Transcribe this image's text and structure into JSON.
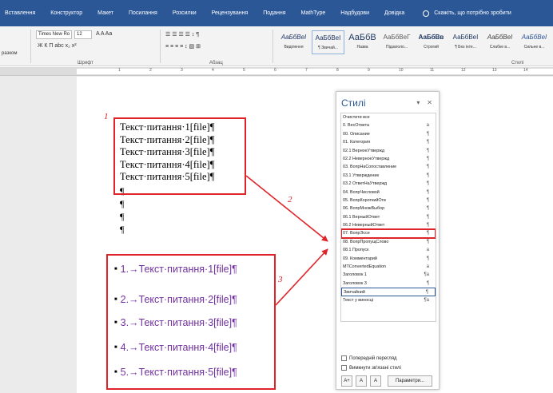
{
  "tabs": [
    "Вставлення",
    "Конструктор",
    "Макет",
    "Посилання",
    "Розсилки",
    "Рецензування",
    "Подання",
    "MathType",
    "Надбудови",
    "Довідка"
  ],
  "tell_me": "Скажіть, що потрібно зробити",
  "ribbon": {
    "font_name": "Times New Ro",
    "font_size": "12",
    "font_group": "Шрифт",
    "para_group": "Абзац",
    "styles_group": "Стилі",
    "clipboard_partial": "разком",
    "font_glyphs": "Ж  К  П  abc  x₂  x²",
    "font_glyphs2": "A  A  Aa",
    "para_glyphs": "☰  ☰  ☰  ☰    ↕  ¶",
    "para_glyphs2": "≡  ≡  ≡  ≡   ↕   ▧  ⊞",
    "styles": [
      {
        "preview": "АаБбВеІ",
        "name": "Виділення"
      },
      {
        "preview": "АаБбВеІ",
        "name": "¶ Звичай..."
      },
      {
        "preview": "АаБбВ",
        "name": "Назва"
      },
      {
        "preview": "АаБбВеГ",
        "name": "Підзаголо..."
      },
      {
        "preview": "АаБбВв",
        "name": "Строгий"
      },
      {
        "preview": "АаБбВеІ",
        "name": "¶ Без інте..."
      },
      {
        "preview": "АаБбВеІ",
        "name": "Слабке в..."
      },
      {
        "preview": "АаБбВеІ",
        "name": "Сильне в..."
      }
    ]
  },
  "ruler_numbers": [
    "1",
    "2",
    "3",
    "4",
    "5",
    "6",
    "7",
    "8",
    "9",
    "10",
    "11",
    "12",
    "13",
    "14"
  ],
  "doc": {
    "lines": [
      "Текст·питання·1[file]¶",
      "Текст·питання·2[file]¶",
      "Текст·питання·3[file]¶",
      "Текст·питання·4[file]¶",
      "Текст·питання·5[file]¶"
    ],
    "para_mark": "¶",
    "numbered": [
      "1.→Текст·питання·1[file]¶",
      "2.→Текст·питання·2[file]¶",
      "3.→Текст·питання·3[file]¶",
      "4.→Текст·питання·4[file]¶",
      "5.→Текст·питання·5[file]¶"
    ],
    "bullet": "■"
  },
  "annotations": {
    "a1": "1",
    "a2": "2",
    "a3": "3"
  },
  "pane": {
    "title": "Стилі",
    "close": "✕",
    "menu": "▾",
    "items": [
      {
        "name": "Очистити все",
        "mark": ""
      },
      {
        "name": "0. ВесОтвета",
        "mark": "a"
      },
      {
        "name": "00. Описание",
        "mark": "¶"
      },
      {
        "name": "01. Категория",
        "mark": "¶"
      },
      {
        "name": "02.1 ВерноеУтвержд",
        "mark": "¶"
      },
      {
        "name": "02.2 НеверноеУтвержд",
        "mark": "¶"
      },
      {
        "name": "03. ВопрНаСопоставление",
        "mark": "¶"
      },
      {
        "name": "03.1 Утверждение",
        "mark": "¶"
      },
      {
        "name": "03.2 ОтветНаУтвержд",
        "mark": "¶"
      },
      {
        "name": "04. ВопрЧисловой",
        "mark": "¶"
      },
      {
        "name": "05. ВопрКороткийОтв",
        "mark": "¶"
      },
      {
        "name": "06. ВопрМножВыбор",
        "mark": "¶"
      },
      {
        "name": "06.1 ВерныйОтвет",
        "mark": "¶"
      },
      {
        "name": "06.2 НеверныйОтвет",
        "mark": "¶"
      },
      {
        "name": "07. ВопрЭссе",
        "mark": "¶"
      },
      {
        "name": "08. ВопрПропущСлово",
        "mark": "¶"
      },
      {
        "name": "08.1 Пропуск",
        "mark": "a"
      },
      {
        "name": "09. Комментарий",
        "mark": "¶"
      },
      {
        "name": "MTConvertedEquation",
        "mark": "a"
      },
      {
        "name": "Заголовок 1",
        "mark": "¶a"
      },
      {
        "name": "Заголовок 3",
        "mark": "¶"
      },
      {
        "name": "Звичайний",
        "mark": "¶"
      },
      {
        "name": "Текст у виносці",
        "mark": "¶a"
      }
    ],
    "preview_label": "Попередній перегляд",
    "linked_label": "Вимкнути зв'язані стилі",
    "options_button": "Параметри..."
  },
  "colors": {
    "accent": "#2b5797",
    "annotation": "#d81b23",
    "numbered_text": "#7030a0"
  }
}
